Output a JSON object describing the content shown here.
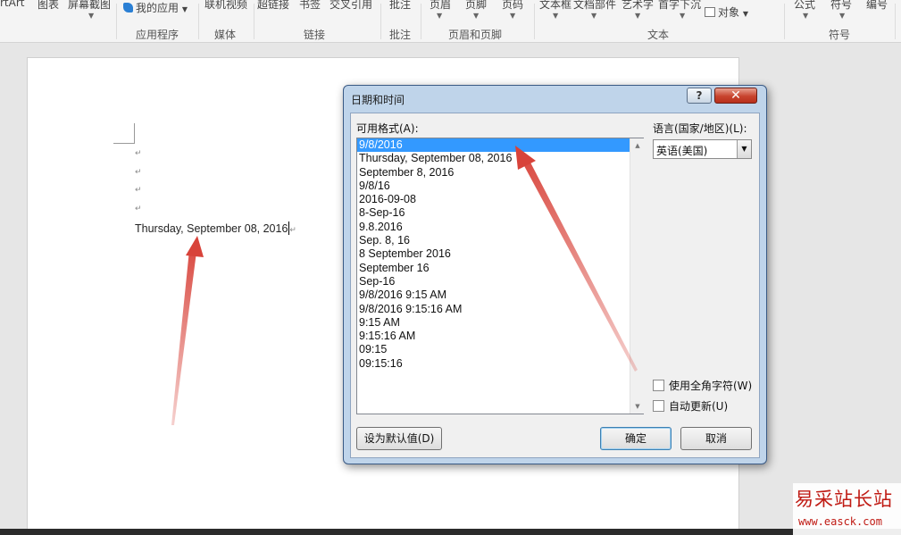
{
  "ribbon": {
    "buttons": [
      "rtArt",
      "图表",
      "屏幕截图",
      "我的应用",
      "联机视频",
      "超链接",
      "书签",
      "交叉引用",
      "批注",
      "页眉",
      "页脚",
      "页码",
      "文本框",
      "文档部件",
      "艺术字",
      "首字下沉",
      "对象",
      "公式",
      "符号",
      "编号"
    ],
    "groups": [
      "应用程序",
      "媒体",
      "链接",
      "批注",
      "页眉和页脚",
      "文本",
      "符号"
    ]
  },
  "document": {
    "inserted_text": "Thursday, September 08, 2016",
    "paragraph_mark": "↵"
  },
  "dialog": {
    "title": "日期和时间",
    "help_label": "?",
    "close_label": "✕",
    "formats_label": "可用格式(A):",
    "formats": [
      "9/8/2016",
      "Thursday, September 08, 2016",
      "September 8, 2016",
      "9/8/16",
      "2016-09-08",
      "8-Sep-16",
      "9.8.2016",
      "Sep. 8, 16",
      "8 September 2016",
      "September 16",
      "Sep-16",
      "9/8/2016 9:15 AM",
      "9/8/2016 9:15:16 AM",
      "9:15 AM",
      "9:15:16 AM",
      "09:15",
      "09:15:16"
    ],
    "selected_index": 0,
    "language_label": "语言(国家/地区)(L):",
    "language_value": "英语(美国)",
    "fullwidth_label": "使用全角字符(W)",
    "autoupdate_label": "自动更新(U)",
    "set_default_label": "设为默认值(D)",
    "ok_label": "确定",
    "cancel_label": "取消"
  },
  "watermark": {
    "title": "易采站长站",
    "url": "www.easck.com"
  },
  "colors": {
    "selection": "#3399ff",
    "arrow": "#d8433a",
    "watermark": "#c01b14"
  }
}
